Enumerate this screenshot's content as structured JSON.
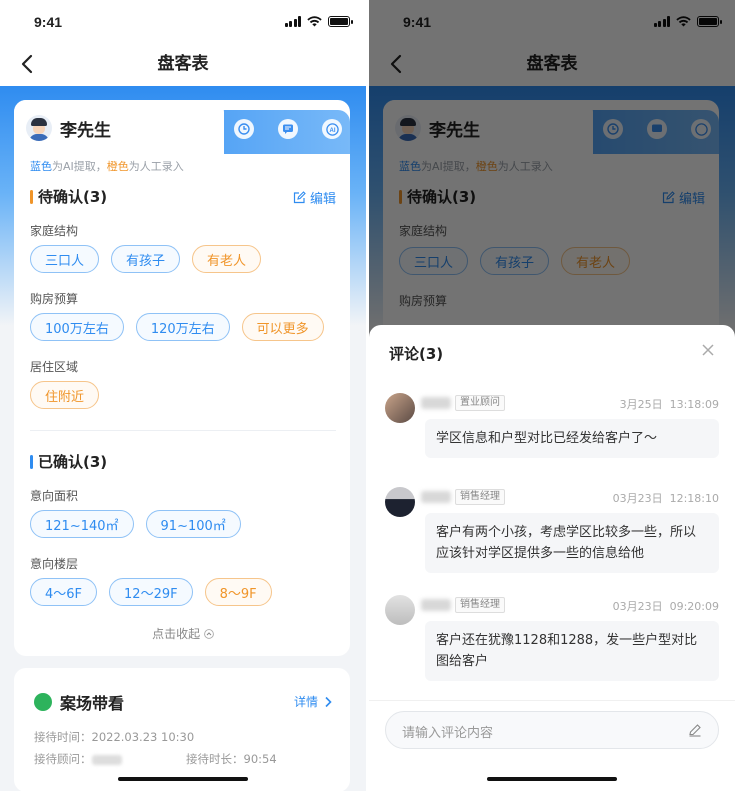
{
  "status": {
    "time": "9:41"
  },
  "nav": {
    "title": "盘客表"
  },
  "profile": {
    "name": "李先生",
    "hint_blue": "蓝色",
    "hint_mid": "为AI提取，",
    "hint_orange": "橙色",
    "hint_end": "为人工录入"
  },
  "pending": {
    "title": "待确认(3)",
    "edit_label": "编辑",
    "groups": [
      {
        "label": "家庭结构",
        "tags": [
          {
            "text": "三口人",
            "color": "blue"
          },
          {
            "text": "有孩子",
            "color": "blue"
          },
          {
            "text": "有老人",
            "color": "orange"
          }
        ]
      },
      {
        "label": "购房预算",
        "tags": [
          {
            "text": "100万左右",
            "color": "blue"
          },
          {
            "text": "120万左右",
            "color": "blue"
          },
          {
            "text": "可以更多",
            "color": "orange"
          }
        ]
      },
      {
        "label": "居住区域",
        "tags": [
          {
            "text": "住附近",
            "color": "orange"
          }
        ]
      }
    ]
  },
  "confirmed": {
    "title": "已确认(3)",
    "groups": [
      {
        "label": "意向面积",
        "tags": [
          {
            "text": "121~140㎡",
            "color": "blue"
          },
          {
            "text": "91~100㎡",
            "color": "blue"
          }
        ]
      },
      {
        "label": "意向楼层",
        "tags": [
          {
            "text": "4～6F",
            "color": "blue"
          },
          {
            "text": "12～29F",
            "color": "blue"
          },
          {
            "text": "8～9F",
            "color": "orange"
          }
        ]
      }
    ],
    "collapse_label": "点击收起"
  },
  "visit": {
    "title": "案场带看",
    "detail_label": "详情",
    "time_label": "接待时间：",
    "time_value": "2022.03.23 10:30",
    "advisor_label": "接待顾问：",
    "duration_label": "接待时长：",
    "duration_value": "90:54"
  },
  "comments": {
    "title": "评论(3)",
    "items": [
      {
        "role": "置业顾问",
        "date": "3月25日",
        "time": "13:18:09",
        "text": "学区信息和户型对比已经发给客户了～"
      },
      {
        "role": "销售经理",
        "date": "03月23日",
        "time": "12:18:10",
        "text": "客户有两个小孩，考虑学区比较多一些，所以应该针对学区提供多一些的信息给他"
      },
      {
        "role": "销售经理",
        "date": "03月23日",
        "time": "09:20:09",
        "text": "客户还在犹豫1128和1288，发一些户型对比图给客户"
      }
    ],
    "input_placeholder": "请输入评论内容"
  },
  "colors": {
    "accent": "#2f8cf0",
    "orange": "#f0952a",
    "green": "#2db35c"
  },
  "icons": [
    "back-arrow-icon",
    "clock-icon",
    "message-icon",
    "ai-icon",
    "edit-icon",
    "chevron-up-icon",
    "chevron-right-icon",
    "close-icon",
    "pen-icon"
  ]
}
